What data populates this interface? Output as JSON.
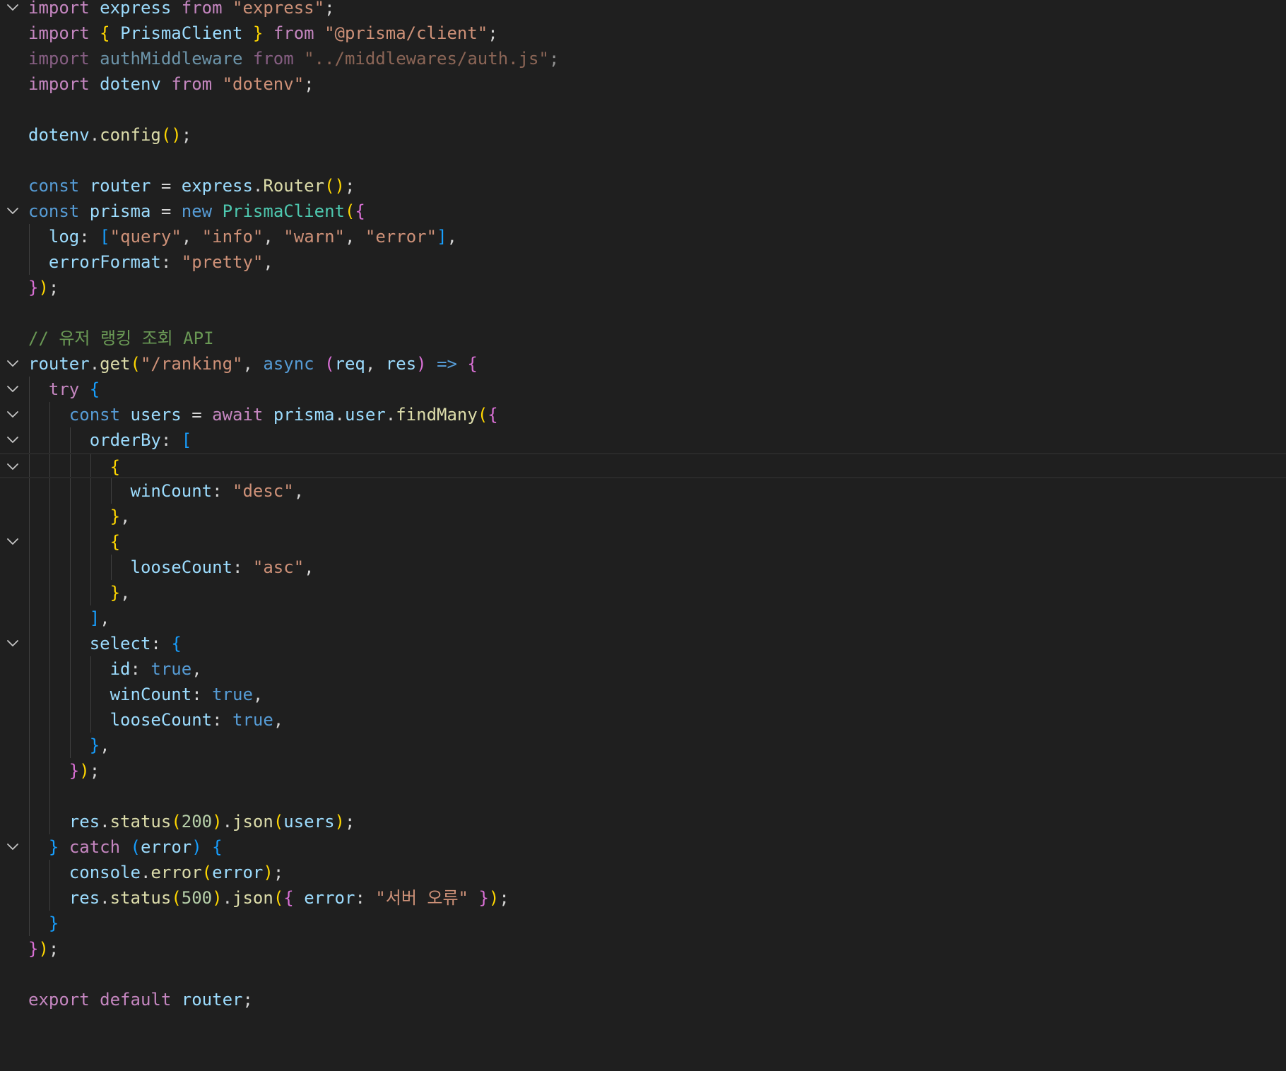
{
  "editor": {
    "language": "javascript",
    "colors": {
      "background": "#1f1f1f",
      "keyword": "#c586c0",
      "string": "#ce9178",
      "variable": "#9cdcfe",
      "function": "#dcdcaa",
      "type": "#4ec9b0",
      "storage": "#569cd6",
      "number": "#b5cea8",
      "comment": "#6a9955",
      "bracket_level_1": "#ffd700",
      "bracket_level_2": "#da70d6",
      "bracket_level_3": "#179fff"
    },
    "fold_icon": "chevron-down-icon",
    "lines": [
      {
        "fold": true,
        "tokens": [
          [
            "kw",
            "import"
          ],
          [
            "tx",
            " "
          ],
          [
            "vr",
            "express"
          ],
          [
            "tx",
            " "
          ],
          [
            "kw",
            "from"
          ],
          [
            "tx",
            " "
          ],
          [
            "st",
            "\"express\""
          ],
          [
            "tx",
            ";"
          ]
        ]
      },
      {
        "fold": false,
        "tokens": [
          [
            "kw",
            "import"
          ],
          [
            "tx",
            " "
          ],
          [
            "b1",
            "{"
          ],
          [
            "tx",
            " "
          ],
          [
            "vr",
            "PrismaClient"
          ],
          [
            "tx",
            " "
          ],
          [
            "b1",
            "}"
          ],
          [
            "tx",
            " "
          ],
          [
            "kw",
            "from"
          ],
          [
            "tx",
            " "
          ],
          [
            "st",
            "\"@prisma/client\""
          ],
          [
            "tx",
            ";"
          ]
        ]
      },
      {
        "fold": false,
        "dim": true,
        "tokens": [
          [
            "kw",
            "import"
          ],
          [
            "tx",
            " "
          ],
          [
            "vr",
            "authMiddleware"
          ],
          [
            "tx",
            " "
          ],
          [
            "kw",
            "from"
          ],
          [
            "tx",
            " "
          ],
          [
            "st",
            "\"../middlewares/auth.js\""
          ],
          [
            "tx",
            ";"
          ]
        ]
      },
      {
        "fold": false,
        "tokens": [
          [
            "kw",
            "import"
          ],
          [
            "tx",
            " "
          ],
          [
            "vr",
            "dotenv"
          ],
          [
            "tx",
            " "
          ],
          [
            "kw",
            "from"
          ],
          [
            "tx",
            " "
          ],
          [
            "st",
            "\"dotenv\""
          ],
          [
            "tx",
            ";"
          ]
        ]
      },
      {
        "fold": false,
        "tokens": []
      },
      {
        "fold": false,
        "tokens": [
          [
            "vr",
            "dotenv"
          ],
          [
            "tx",
            "."
          ],
          [
            "fn",
            "config"
          ],
          [
            "b1",
            "()"
          ],
          [
            "tx",
            ";"
          ]
        ]
      },
      {
        "fold": false,
        "tokens": []
      },
      {
        "fold": false,
        "tokens": [
          [
            "bl",
            "const"
          ],
          [
            "tx",
            " "
          ],
          [
            "vr",
            "router"
          ],
          [
            "tx",
            " = "
          ],
          [
            "vr",
            "express"
          ],
          [
            "tx",
            "."
          ],
          [
            "fn",
            "Router"
          ],
          [
            "b1",
            "()"
          ],
          [
            "tx",
            ";"
          ]
        ]
      },
      {
        "fold": true,
        "tokens": [
          [
            "bl",
            "const"
          ],
          [
            "tx",
            " "
          ],
          [
            "vr",
            "prisma"
          ],
          [
            "tx",
            " = "
          ],
          [
            "bl",
            "new"
          ],
          [
            "tx",
            " "
          ],
          [
            "ty",
            "PrismaClient"
          ],
          [
            "b1",
            "("
          ],
          [
            "b2",
            "{"
          ]
        ]
      },
      {
        "fold": false,
        "tokens": [
          [
            "tx",
            "  "
          ],
          [
            "vr",
            "log"
          ],
          [
            "tx",
            ": "
          ],
          [
            "b3",
            "["
          ],
          [
            "st",
            "\"query\""
          ],
          [
            "tx",
            ", "
          ],
          [
            "st",
            "\"info\""
          ],
          [
            "tx",
            ", "
          ],
          [
            "st",
            "\"warn\""
          ],
          [
            "tx",
            ", "
          ],
          [
            "st",
            "\"error\""
          ],
          [
            "b3",
            "]"
          ],
          [
            "tx",
            ","
          ]
        ]
      },
      {
        "fold": false,
        "tokens": [
          [
            "tx",
            "  "
          ],
          [
            "vr",
            "errorFormat"
          ],
          [
            "tx",
            ": "
          ],
          [
            "st",
            "\"pretty\""
          ],
          [
            "tx",
            ","
          ]
        ]
      },
      {
        "fold": false,
        "tokens": [
          [
            "b2",
            "}"
          ],
          [
            "b1",
            ")"
          ],
          [
            "tx",
            ";"
          ]
        ]
      },
      {
        "fold": false,
        "tokens": []
      },
      {
        "fold": false,
        "tokens": [
          [
            "cm",
            "// 유저 랭킹 조회 API"
          ]
        ]
      },
      {
        "fold": true,
        "tokens": [
          [
            "vr",
            "router"
          ],
          [
            "tx",
            "."
          ],
          [
            "fn",
            "get"
          ],
          [
            "b1",
            "("
          ],
          [
            "st",
            "\"/ranking\""
          ],
          [
            "tx",
            ", "
          ],
          [
            "bl",
            "async"
          ],
          [
            "tx",
            " "
          ],
          [
            "b2",
            "("
          ],
          [
            "vr",
            "req"
          ],
          [
            "tx",
            ", "
          ],
          [
            "vr",
            "res"
          ],
          [
            "b2",
            ")"
          ],
          [
            "tx",
            " "
          ],
          [
            "bl",
            "=>"
          ],
          [
            "tx",
            " "
          ],
          [
            "b2",
            "{"
          ]
        ]
      },
      {
        "fold": true,
        "tokens": [
          [
            "tx",
            "  "
          ],
          [
            "kw",
            "try"
          ],
          [
            "tx",
            " "
          ],
          [
            "b3",
            "{"
          ]
        ]
      },
      {
        "fold": true,
        "tokens": [
          [
            "tx",
            "    "
          ],
          [
            "bl",
            "const"
          ],
          [
            "tx",
            " "
          ],
          [
            "vr",
            "users"
          ],
          [
            "tx",
            " = "
          ],
          [
            "kw",
            "await"
          ],
          [
            "tx",
            " "
          ],
          [
            "vr",
            "prisma"
          ],
          [
            "tx",
            "."
          ],
          [
            "vr",
            "user"
          ],
          [
            "tx",
            "."
          ],
          [
            "fn",
            "findMany"
          ],
          [
            "b1",
            "("
          ],
          [
            "b2",
            "{"
          ]
        ]
      },
      {
        "fold": true,
        "tokens": [
          [
            "tx",
            "      "
          ],
          [
            "vr",
            "orderBy"
          ],
          [
            "tx",
            ": "
          ],
          [
            "b3",
            "["
          ]
        ]
      },
      {
        "fold": true,
        "current": true,
        "tokens": [
          [
            "tx",
            "        "
          ],
          [
            "b1",
            "{"
          ]
        ]
      },
      {
        "fold": false,
        "tokens": [
          [
            "tx",
            "          "
          ],
          [
            "vr",
            "winCount"
          ],
          [
            "tx",
            ": "
          ],
          [
            "st",
            "\"desc\""
          ],
          [
            "tx",
            ","
          ]
        ]
      },
      {
        "fold": false,
        "tokens": [
          [
            "tx",
            "        "
          ],
          [
            "b1",
            "}"
          ],
          [
            "tx",
            ","
          ]
        ]
      },
      {
        "fold": true,
        "tokens": [
          [
            "tx",
            "        "
          ],
          [
            "b1",
            "{"
          ]
        ]
      },
      {
        "fold": false,
        "tokens": [
          [
            "tx",
            "          "
          ],
          [
            "vr",
            "looseCount"
          ],
          [
            "tx",
            ": "
          ],
          [
            "st",
            "\"asc\""
          ],
          [
            "tx",
            ","
          ]
        ]
      },
      {
        "fold": false,
        "tokens": [
          [
            "tx",
            "        "
          ],
          [
            "b1",
            "}"
          ],
          [
            "tx",
            ","
          ]
        ]
      },
      {
        "fold": false,
        "tokens": [
          [
            "tx",
            "      "
          ],
          [
            "b3",
            "]"
          ],
          [
            "tx",
            ","
          ]
        ]
      },
      {
        "fold": true,
        "tokens": [
          [
            "tx",
            "      "
          ],
          [
            "vr",
            "select"
          ],
          [
            "tx",
            ": "
          ],
          [
            "b3",
            "{"
          ]
        ]
      },
      {
        "fold": false,
        "tokens": [
          [
            "tx",
            "        "
          ],
          [
            "vr",
            "id"
          ],
          [
            "tx",
            ": "
          ],
          [
            "bl",
            "true"
          ],
          [
            "tx",
            ","
          ]
        ]
      },
      {
        "fold": false,
        "tokens": [
          [
            "tx",
            "        "
          ],
          [
            "vr",
            "winCount"
          ],
          [
            "tx",
            ": "
          ],
          [
            "bl",
            "true"
          ],
          [
            "tx",
            ","
          ]
        ]
      },
      {
        "fold": false,
        "tokens": [
          [
            "tx",
            "        "
          ],
          [
            "vr",
            "looseCount"
          ],
          [
            "tx",
            ": "
          ],
          [
            "bl",
            "true"
          ],
          [
            "tx",
            ","
          ]
        ]
      },
      {
        "fold": false,
        "tokens": [
          [
            "tx",
            "      "
          ],
          [
            "b3",
            "}"
          ],
          [
            "tx",
            ","
          ]
        ]
      },
      {
        "fold": false,
        "tokens": [
          [
            "tx",
            "    "
          ],
          [
            "b2",
            "}"
          ],
          [
            "b1",
            ")"
          ],
          [
            "tx",
            ";"
          ]
        ]
      },
      {
        "fold": false,
        "tokens": []
      },
      {
        "fold": false,
        "tokens": [
          [
            "tx",
            "    "
          ],
          [
            "vr",
            "res"
          ],
          [
            "tx",
            "."
          ],
          [
            "fn",
            "status"
          ],
          [
            "b1",
            "("
          ],
          [
            "nm",
            "200"
          ],
          [
            "b1",
            ")"
          ],
          [
            "tx",
            "."
          ],
          [
            "fn",
            "json"
          ],
          [
            "b1",
            "("
          ],
          [
            "vr",
            "users"
          ],
          [
            "b1",
            ")"
          ],
          [
            "tx",
            ";"
          ]
        ]
      },
      {
        "fold": true,
        "tokens": [
          [
            "tx",
            "  "
          ],
          [
            "b3",
            "}"
          ],
          [
            "tx",
            " "
          ],
          [
            "kw",
            "catch"
          ],
          [
            "tx",
            " "
          ],
          [
            "b3",
            "("
          ],
          [
            "vr",
            "error"
          ],
          [
            "b3",
            ")"
          ],
          [
            "tx",
            " "
          ],
          [
            "b3",
            "{"
          ]
        ]
      },
      {
        "fold": false,
        "tokens": [
          [
            "tx",
            "    "
          ],
          [
            "vr",
            "console"
          ],
          [
            "tx",
            "."
          ],
          [
            "fn",
            "error"
          ],
          [
            "b1",
            "("
          ],
          [
            "vr",
            "error"
          ],
          [
            "b1",
            ")"
          ],
          [
            "tx",
            ";"
          ]
        ]
      },
      {
        "fold": false,
        "tokens": [
          [
            "tx",
            "    "
          ],
          [
            "vr",
            "res"
          ],
          [
            "tx",
            "."
          ],
          [
            "fn",
            "status"
          ],
          [
            "b1",
            "("
          ],
          [
            "nm",
            "500"
          ],
          [
            "b1",
            ")"
          ],
          [
            "tx",
            "."
          ],
          [
            "fn",
            "json"
          ],
          [
            "b1",
            "("
          ],
          [
            "b2",
            "{"
          ],
          [
            "tx",
            " "
          ],
          [
            "vr",
            "error"
          ],
          [
            "tx",
            ": "
          ],
          [
            "st",
            "\"서버 오류\""
          ],
          [
            "tx",
            " "
          ],
          [
            "b2",
            "}"
          ],
          [
            "b1",
            ")"
          ],
          [
            "tx",
            ";"
          ]
        ]
      },
      {
        "fold": false,
        "tokens": [
          [
            "tx",
            "  "
          ],
          [
            "b3",
            "}"
          ]
        ]
      },
      {
        "fold": false,
        "tokens": [
          [
            "b2",
            "}"
          ],
          [
            "b1",
            ")"
          ],
          [
            "tx",
            ";"
          ]
        ]
      },
      {
        "fold": false,
        "tokens": []
      },
      {
        "fold": false,
        "tokens": [
          [
            "kw",
            "export"
          ],
          [
            "tx",
            " "
          ],
          [
            "kw",
            "default"
          ],
          [
            "tx",
            " "
          ],
          [
            "vr",
            "router"
          ],
          [
            "tx",
            ";"
          ]
        ]
      }
    ]
  }
}
